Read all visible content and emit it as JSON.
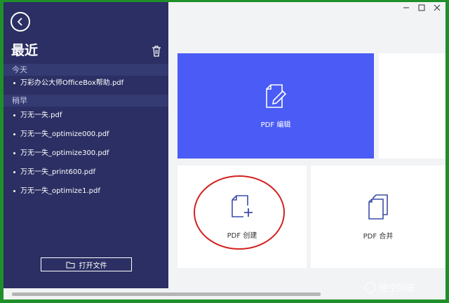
{
  "sidebar": {
    "title": "最近",
    "sections": [
      {
        "label": "今天",
        "files": [
          "万彩办公大师OfficeBox帮助.pdf"
        ]
      },
      {
        "label": "稍早",
        "files": [
          "万无一失.pdf",
          "万无一失_optimize000.pdf",
          "万无一失_optimize300.pdf",
          "万无一失_print600.pdf",
          "万无一失_optimize1.pdf"
        ]
      }
    ],
    "open_button": "打开文件"
  },
  "main": {
    "cards": [
      {
        "label": "PDF 编辑",
        "icon": "pdf-edit-icon",
        "active": true
      },
      {
        "label": "PDF 创建",
        "icon": "pdf-create-icon",
        "active": false
      },
      {
        "label": "PDF 合并",
        "icon": "pdf-merge-icon",
        "active": false
      }
    ]
  },
  "colors": {
    "sidebar_bg": "#2b2f63",
    "accent": "#4a5cf5",
    "annotation": "#d42020"
  },
  "watermark": "悟空问答"
}
